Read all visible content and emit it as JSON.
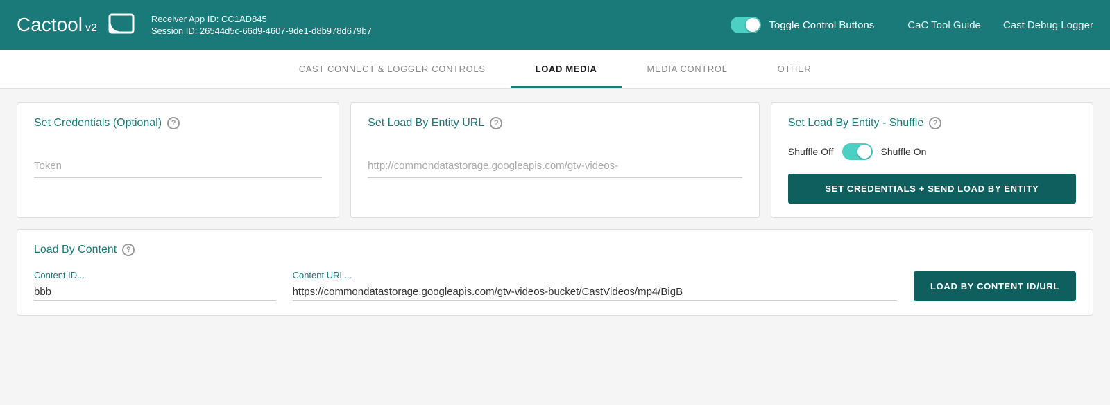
{
  "header": {
    "logo_text": "Cactool",
    "logo_version": "v2",
    "receiver_app_id_label": "Receiver App ID: CC1AD845",
    "session_id_label": "Session ID: 26544d5c-66d9-4607-9de1-d8b978d679b7",
    "toggle_label": "Toggle Control Buttons",
    "nav_link_guide": "CaC Tool Guide",
    "nav_link_logger": "Cast Debug Logger",
    "brand_color": "#1a7a7a"
  },
  "tabs": [
    {
      "id": "cast-connect",
      "label": "CAST CONNECT & LOGGER CONTROLS",
      "active": false
    },
    {
      "id": "load-media",
      "label": "LOAD MEDIA",
      "active": true
    },
    {
      "id": "media-control",
      "label": "MEDIA CONTROL",
      "active": false
    },
    {
      "id": "other",
      "label": "OTHER",
      "active": false
    }
  ],
  "sections": {
    "credentials": {
      "title": "Set Credentials (Optional)",
      "token_placeholder": "Token"
    },
    "entity_url": {
      "title": "Set Load By Entity URL",
      "url_placeholder": "http://commondatastorage.googleapis.com/gtv-videos-"
    },
    "shuffle": {
      "title": "Set Load By Entity - Shuffle",
      "shuffle_off": "Shuffle Off",
      "shuffle_on": "Shuffle On",
      "button_label": "SET CREDENTIALS + SEND LOAD BY ENTITY"
    },
    "load_by_content": {
      "title": "Load By Content",
      "content_id_label": "Content ID...",
      "content_id_value": "bbb",
      "content_url_label": "Content URL...",
      "content_url_value": "https://commondatastorage.googleapis.com/gtv-videos-bucket/CastVideos/mp4/BigB",
      "button_label": "LOAD BY CONTENT ID/URL"
    }
  },
  "icons": {
    "help": "?",
    "cast": "⊡"
  }
}
